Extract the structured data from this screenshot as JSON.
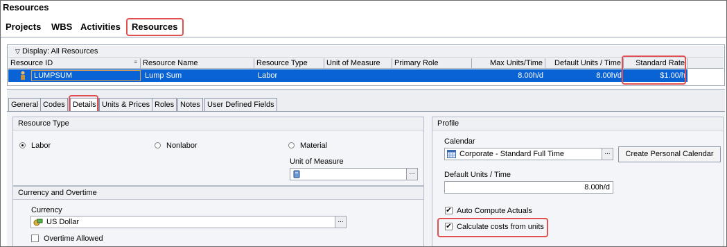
{
  "window": {
    "title": "Resources"
  },
  "main_tabs": {
    "projects": "Projects",
    "wbs": "WBS",
    "activities": "Activities",
    "resources": "Resources"
  },
  "grid": {
    "display_label": "Display: All Resources",
    "columns": {
      "resource_id": "Resource ID",
      "resource_name": "Resource Name",
      "resource_type": "Resource Type",
      "unit_of_measure": "Unit of Measure",
      "primary_role": "Primary Role",
      "max_units": "Max Units/Time",
      "default_units": "Default Units / Time",
      "standard_rate": "Standard Rate"
    },
    "row": {
      "resource_id": "LUMPSUM",
      "resource_name": "Lump Sum",
      "resource_type": "Labor",
      "unit_of_measure": "",
      "primary_role": "",
      "max_units": "8.00h/d",
      "default_units": "8.00h/d",
      "standard_rate": "$1.00/h"
    }
  },
  "detail_tabs": {
    "general": "General",
    "codes": "Codes",
    "details": "Details",
    "units_prices": "Units & Prices",
    "roles": "Roles",
    "notes": "Notes",
    "udf": "User Defined Fields"
  },
  "resource_type": {
    "header": "Resource Type",
    "labor": "Labor",
    "nonlabor": "Nonlabor",
    "material": "Material",
    "selected": "Labor",
    "unit_of_measure_label": "Unit of Measure",
    "unit_of_measure_value": ""
  },
  "currency_group": {
    "header": "Currency and Overtime",
    "currency_label": "Currency",
    "currency_value": "US Dollar",
    "overtime_label": "Overtime Allowed",
    "overtime_checked": false
  },
  "profile": {
    "header": "Profile",
    "calendar_label": "Calendar",
    "calendar_value": "Corporate - Standard Full Time",
    "create_calendar_button": "Create Personal Calendar",
    "default_units_label": "Default Units / Time",
    "default_units_value": "8.00h/d",
    "auto_compute_label": "Auto Compute Actuals",
    "auto_compute_checked": true,
    "calc_costs_label": "Calculate costs from units",
    "calc_costs_checked": true
  },
  "ellipsis": "...",
  "checkmark": "✔",
  "accent_colors": {
    "selection": "#0a63d4",
    "highlight": "#e05050"
  }
}
